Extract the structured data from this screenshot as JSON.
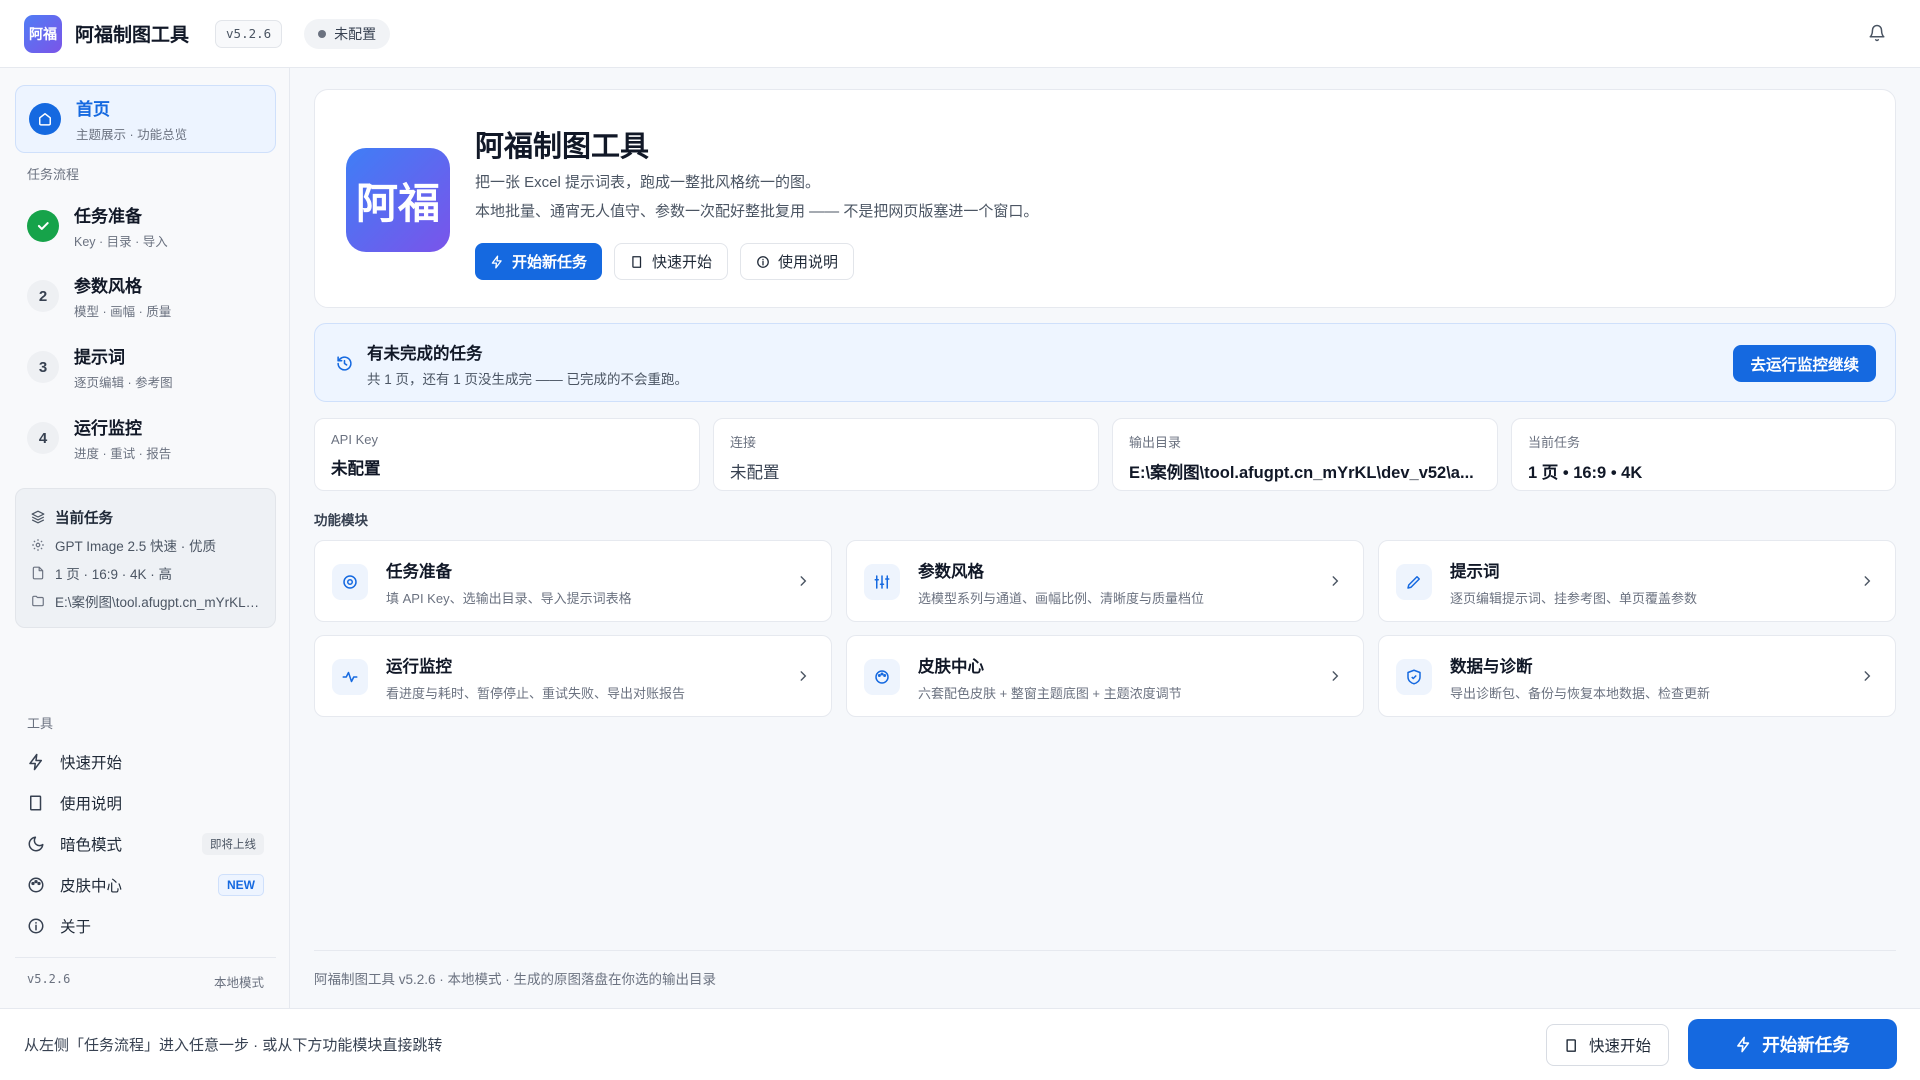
{
  "app": {
    "logo_text": "阿福",
    "title": "阿福制图工具",
    "version": "v5.2.6",
    "status": "未配置"
  },
  "sidebar": {
    "home": {
      "title": "首页",
      "subtitle": "主题展示 · 功能总览"
    },
    "workflow_label": "任务流程",
    "steps": [
      {
        "num": "",
        "title": "任务准备",
        "subtitle": "Key · 目录 · 导入",
        "done": true
      },
      {
        "num": "2",
        "title": "参数风格",
        "subtitle": "模型 · 画幅 · 质量"
      },
      {
        "num": "3",
        "title": "提示词",
        "subtitle": "逐页编辑 · 参考图"
      },
      {
        "num": "4",
        "title": "运行监控",
        "subtitle": "进度 · 重试 · 报告"
      }
    ],
    "current_task": {
      "title": "当前任务",
      "model": "GPT Image 2.5 快速 · 优质",
      "spec": "1 页 · 16:9 · 4K · 高",
      "path": "E:\\案例图\\tool.afugpt.cn_mYrKL\\dev_v52\\a..."
    },
    "tools_label": "工具",
    "tools": [
      {
        "label": "快速开始",
        "icon": "lightning-icon"
      },
      {
        "label": "使用说明",
        "icon": "book-icon"
      },
      {
        "label": "暗色模式",
        "icon": "moon-icon",
        "tag": "即将上线"
      },
      {
        "label": "皮肤中心",
        "icon": "palette-icon",
        "tag": "NEW"
      },
      {
        "label": "关于",
        "icon": "info-icon"
      }
    ],
    "footer": {
      "version": "v5.2.6",
      "mode": "本地模式"
    }
  },
  "hero": {
    "logo_text": "阿福",
    "title": "阿福制图工具",
    "desc1": "把一张 Excel 提示词表，跑成一整批风格统一的图。",
    "desc2": "本地批量、通宵无人值守、参数一次配好整批复用 —— 不是把网页版塞进一个窗口。",
    "btn_start": "开始新任务",
    "btn_quick": "快速开始",
    "btn_help": "使用说明"
  },
  "resume": {
    "title": "有未完成的任务",
    "subtitle": "共 1 页，还有 1 页没生成完 —— 已完成的不会重跑。",
    "button": "去运行监控继续"
  },
  "stats": [
    {
      "label": "API Key",
      "value": "未配置"
    },
    {
      "label": "连接",
      "value": "未配置"
    },
    {
      "label": "输出目录",
      "value": "E:\\案例图\\tool.afugpt.cn_mYrKL\\dev_v52\\a..."
    },
    {
      "label": "当前任务",
      "value": "1 页 • 16:9 • 4K"
    }
  ],
  "modules_label": "功能模块",
  "modules": [
    {
      "title": "任务准备",
      "subtitle": "填 API Key、选输出目录、导入提示词表格",
      "icon": "target-icon"
    },
    {
      "title": "参数风格",
      "subtitle": "选模型系列与通道、画幅比例、清晰度与质量档位",
      "icon": "sliders-icon"
    },
    {
      "title": "提示词",
      "subtitle": "逐页编辑提示词、挂参考图、单页覆盖参数",
      "icon": "pencil-icon"
    },
    {
      "title": "运行监控",
      "subtitle": "看进度与耗时、暂停停止、重试失败、导出对账报告",
      "icon": "activity-icon"
    },
    {
      "title": "皮肤中心",
      "subtitle": "六套配色皮肤 + 整窗主题底图 + 主题浓度调节",
      "icon": "palette-icon"
    },
    {
      "title": "数据与诊断",
      "subtitle": "导出诊断包、备份与恢复本地数据、检查更新",
      "icon": "shield-icon"
    }
  ],
  "main_footer": "阿福制图工具 v5.2.6 · 本地模式 · 生成的原图落盘在你选的输出目录",
  "bottom": {
    "hint": "从左侧「任务流程」进入任意一步 · 或从下方功能模块直接跳转",
    "quick": "快速开始",
    "start": "开始新任务"
  },
  "colors": {
    "accent": "#1569e0",
    "success": "#16a34a",
    "page_bg": "#f6f8fb"
  }
}
